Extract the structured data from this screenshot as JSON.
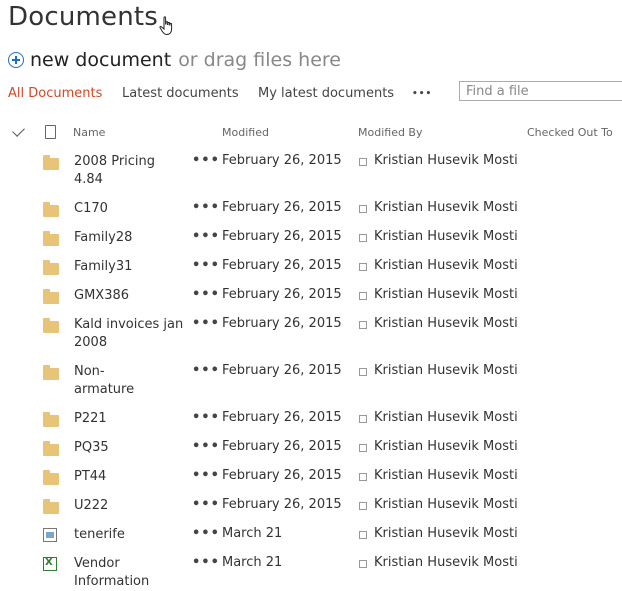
{
  "page": {
    "title": "Documents"
  },
  "commands": {
    "new_document_label": "new document",
    "drag_hint": "or drag files here"
  },
  "views": {
    "all_documents": "All Documents",
    "latest_documents": "Latest documents",
    "my_latest_documents": "My latest documents",
    "more": "•••"
  },
  "search": {
    "placeholder": "Find a file"
  },
  "columns": {
    "name": "Name",
    "modified": "Modified",
    "modified_by": "Modified By",
    "checked_out_to": "Checked Out To"
  },
  "colors": {
    "accent": "#d24726",
    "folder": "#e8c478",
    "link_blue": "#1f6fc2"
  },
  "row_menu": "•••",
  "rows": [
    {
      "icon": "folder-icon",
      "name": "2008 Pricing 4.84",
      "modified": "February 26, 2015",
      "modified_by": "Kristian Husevik Mosti"
    },
    {
      "icon": "folder-icon",
      "name": "C170",
      "modified": "February 26, 2015",
      "modified_by": "Kristian Husevik Mosti"
    },
    {
      "icon": "folder-icon",
      "name": "Family28",
      "modified": "February 26, 2015",
      "modified_by": "Kristian Husevik Mosti"
    },
    {
      "icon": "folder-icon",
      "name": "Family31",
      "modified": "February 26, 2015",
      "modified_by": "Kristian Husevik Mosti"
    },
    {
      "icon": "folder-icon",
      "name": "GMX386",
      "modified": "February 26, 2015",
      "modified_by": "Kristian Husevik Mosti"
    },
    {
      "icon": "folder-icon",
      "name": "Kald invoices jan 2008",
      "modified": "February 26, 2015",
      "modified_by": "Kristian Husevik Mosti"
    },
    {
      "icon": "folder-icon",
      "name": "Non-armature",
      "modified": "February 26, 2015",
      "modified_by": "Kristian Husevik Mosti"
    },
    {
      "icon": "folder-icon",
      "name": "P221",
      "modified": "February 26, 2015",
      "modified_by": "Kristian Husevik Mosti"
    },
    {
      "icon": "folder-icon",
      "name": "PQ35",
      "modified": "February 26, 2015",
      "modified_by": "Kristian Husevik Mosti"
    },
    {
      "icon": "folder-icon",
      "name": "PT44",
      "modified": "February 26, 2015",
      "modified_by": "Kristian Husevik Mosti"
    },
    {
      "icon": "folder-icon",
      "name": "U222",
      "modified": "February 26, 2015",
      "modified_by": "Kristian Husevik Mosti"
    },
    {
      "icon": "image-file-icon",
      "name": "tenerife",
      "modified": "March 21",
      "modified_by": "Kristian Husevik Mosti"
    },
    {
      "icon": "excel-file-icon",
      "name": "Vendor Information",
      "modified": "March 21",
      "modified_by": "Kristian Husevik Mosti"
    }
  ]
}
